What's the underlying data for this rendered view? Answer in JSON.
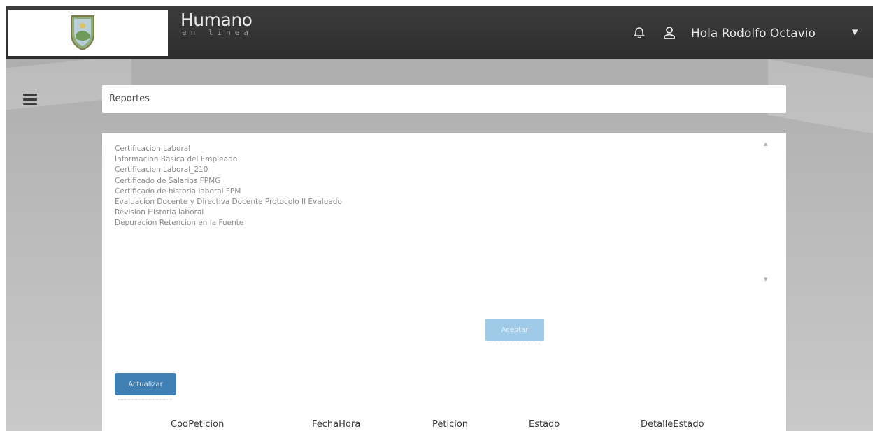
{
  "header": {
    "brand_main": "Humano",
    "brand_sub": "en linea",
    "greeting": "Hola Rodolfo Octavio",
    "caret": "▾"
  },
  "page": {
    "title": "Reportes"
  },
  "reports": {
    "items": [
      "Certificacion Laboral",
      "Informacion Basica del Empleado",
      "Certificacion Laboral_210",
      "Certificado de Salarios FPMG",
      "Certificado de historia laboral FPM",
      "Evaluacion Docente y Directiva Docente Protocolo II Evaluado",
      "Revision Historia laboral",
      "Depuracion Retencion en la Fuente"
    ]
  },
  "actions": {
    "aceptar_label": "Aceptar",
    "actualizar_label": "Actualizar"
  },
  "table": {
    "columns": [
      "CodPeticion",
      "FechaHora",
      "Peticion",
      "Estado",
      "DetalleEstado"
    ]
  },
  "icons": {
    "bell": "bell-icon",
    "user": "user-icon",
    "menu": "menu-icon",
    "shield": "shield-logo"
  },
  "colors": {
    "topbar": "#2f2f2f",
    "accent_button": "#3f7fb3",
    "disabled_button": "#9fcbe8"
  }
}
